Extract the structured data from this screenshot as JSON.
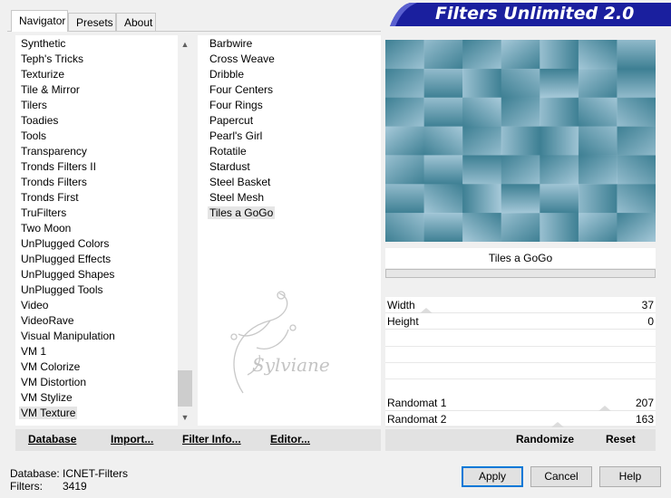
{
  "tabs": [
    "Navigator",
    "Presets",
    "About"
  ],
  "banner": {
    "title": "Filters Unlimited 2.0"
  },
  "categories": [
    "Synthetic",
    "Teph's Tricks",
    "Texturize",
    "Tile & Mirror",
    "Tilers",
    "Toadies",
    "Tools",
    "Transparency",
    "Tronds Filters II",
    "Tronds Filters",
    "Tronds First",
    "TruFilters",
    "Two Moon",
    "UnPlugged Colors",
    "UnPlugged Effects",
    "UnPlugged Shapes",
    "UnPlugged Tools",
    "Video",
    "VideoRave",
    "Visual Manipulation",
    "VM 1",
    "VM Colorize",
    "VM Distortion",
    "VM Stylize",
    "VM Texture"
  ],
  "selected_category": "VM Texture",
  "filters": [
    "Barbwire",
    "Cross Weave",
    "Dribble",
    "Four Centers",
    "Four Rings",
    "Papercut",
    "Pearl's Girl",
    "Rotatile",
    "Stardust",
    "Steel Basket",
    "Steel Mesh",
    "Tiles a GoGo"
  ],
  "selected_filter": "Tiles a GoGo",
  "watermark": "Sylviane",
  "filter_name": "Tiles a GoGo",
  "params": [
    {
      "label": "Width",
      "value": "37",
      "fraction": 0.15
    },
    {
      "label": "Height",
      "value": "0",
      "fraction": 0.0
    },
    {
      "label": "Randomat 1",
      "value": "207",
      "fraction": 0.81
    },
    {
      "label": "Randomat 2",
      "value": "163",
      "fraction": 0.64
    }
  ],
  "left_buttons": [
    "Database",
    "Import...",
    "Filter Info...",
    "Editor..."
  ],
  "right_buttons": [
    "Randomize",
    "Reset"
  ],
  "status": {
    "database_label": "Database:",
    "database_value": "ICNET-Filters",
    "filters_label": "Filters:",
    "filters_value": "3419"
  },
  "dialog_buttons": {
    "apply": "Apply",
    "cancel": "Cancel",
    "help": "Help"
  },
  "colors": {
    "banner": "#1a1f9e",
    "tile_base": "#3d7f93",
    "tile_light": "#a9cbdb",
    "selection": "#e5e5e5",
    "default_button_border": "#0078d7"
  }
}
